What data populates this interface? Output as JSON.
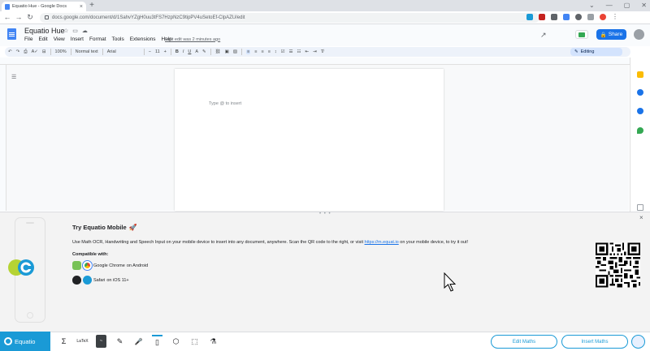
{
  "browser": {
    "tab_title": "Equatio Hue - Google Docs",
    "tab_close": "×",
    "new_tab": "+",
    "url": "docs.google.com/document/d/1SahvYZgH0uu3tFS7HzpNzC9tipPV4uSetoEf-ClpAZU/edit",
    "window_controls": [
      "⌄",
      "—",
      "▢",
      "✕"
    ]
  },
  "docs": {
    "title": "Equatio Hue",
    "menu": [
      "File",
      "Edit",
      "View",
      "Insert",
      "Format",
      "Tools",
      "Extensions",
      "Help"
    ],
    "last_edit": "Last edit was 2 minutes ago",
    "share_label": "Share",
    "zoom": "100%",
    "style": "Normal text",
    "font": "Arial",
    "font_size": "11",
    "mode_label": "Editing",
    "placeholder": "Type @ to insert"
  },
  "equatio_panel": {
    "title": "Try Equatio Mobile",
    "description_pre": "Use Math OCR, Handwriting and Speech Input on your mobile device to insert into any document, anywhere. Scan the QR code to the right, or visit ",
    "link": "https://m.equat.io",
    "description_post": " on your mobile device, to try it out!",
    "compat_label": "Compatible with:",
    "browsers": [
      {
        "name": "Google Chrome",
        "platform": "on Android",
        "icon": "chrome-icon",
        "os_icon": "android-icon"
      },
      {
        "name": "Safari",
        "platform": "on iOS 11+",
        "icon": "safari-icon",
        "os_icon": "apple-icon"
      }
    ],
    "close": "×"
  },
  "equatio_bar": {
    "brand": "Equatio",
    "tools": [
      "Σ",
      "LaTeX",
      "~",
      "✎",
      "🎤",
      "▯",
      "⬡",
      "⬚",
      "⚗"
    ],
    "edit_label": "Edit Maths",
    "insert_label": "Insert Maths"
  },
  "colors": {
    "equatio_blue": "#1a9ad6",
    "docs_blue": "#1a73e8"
  }
}
